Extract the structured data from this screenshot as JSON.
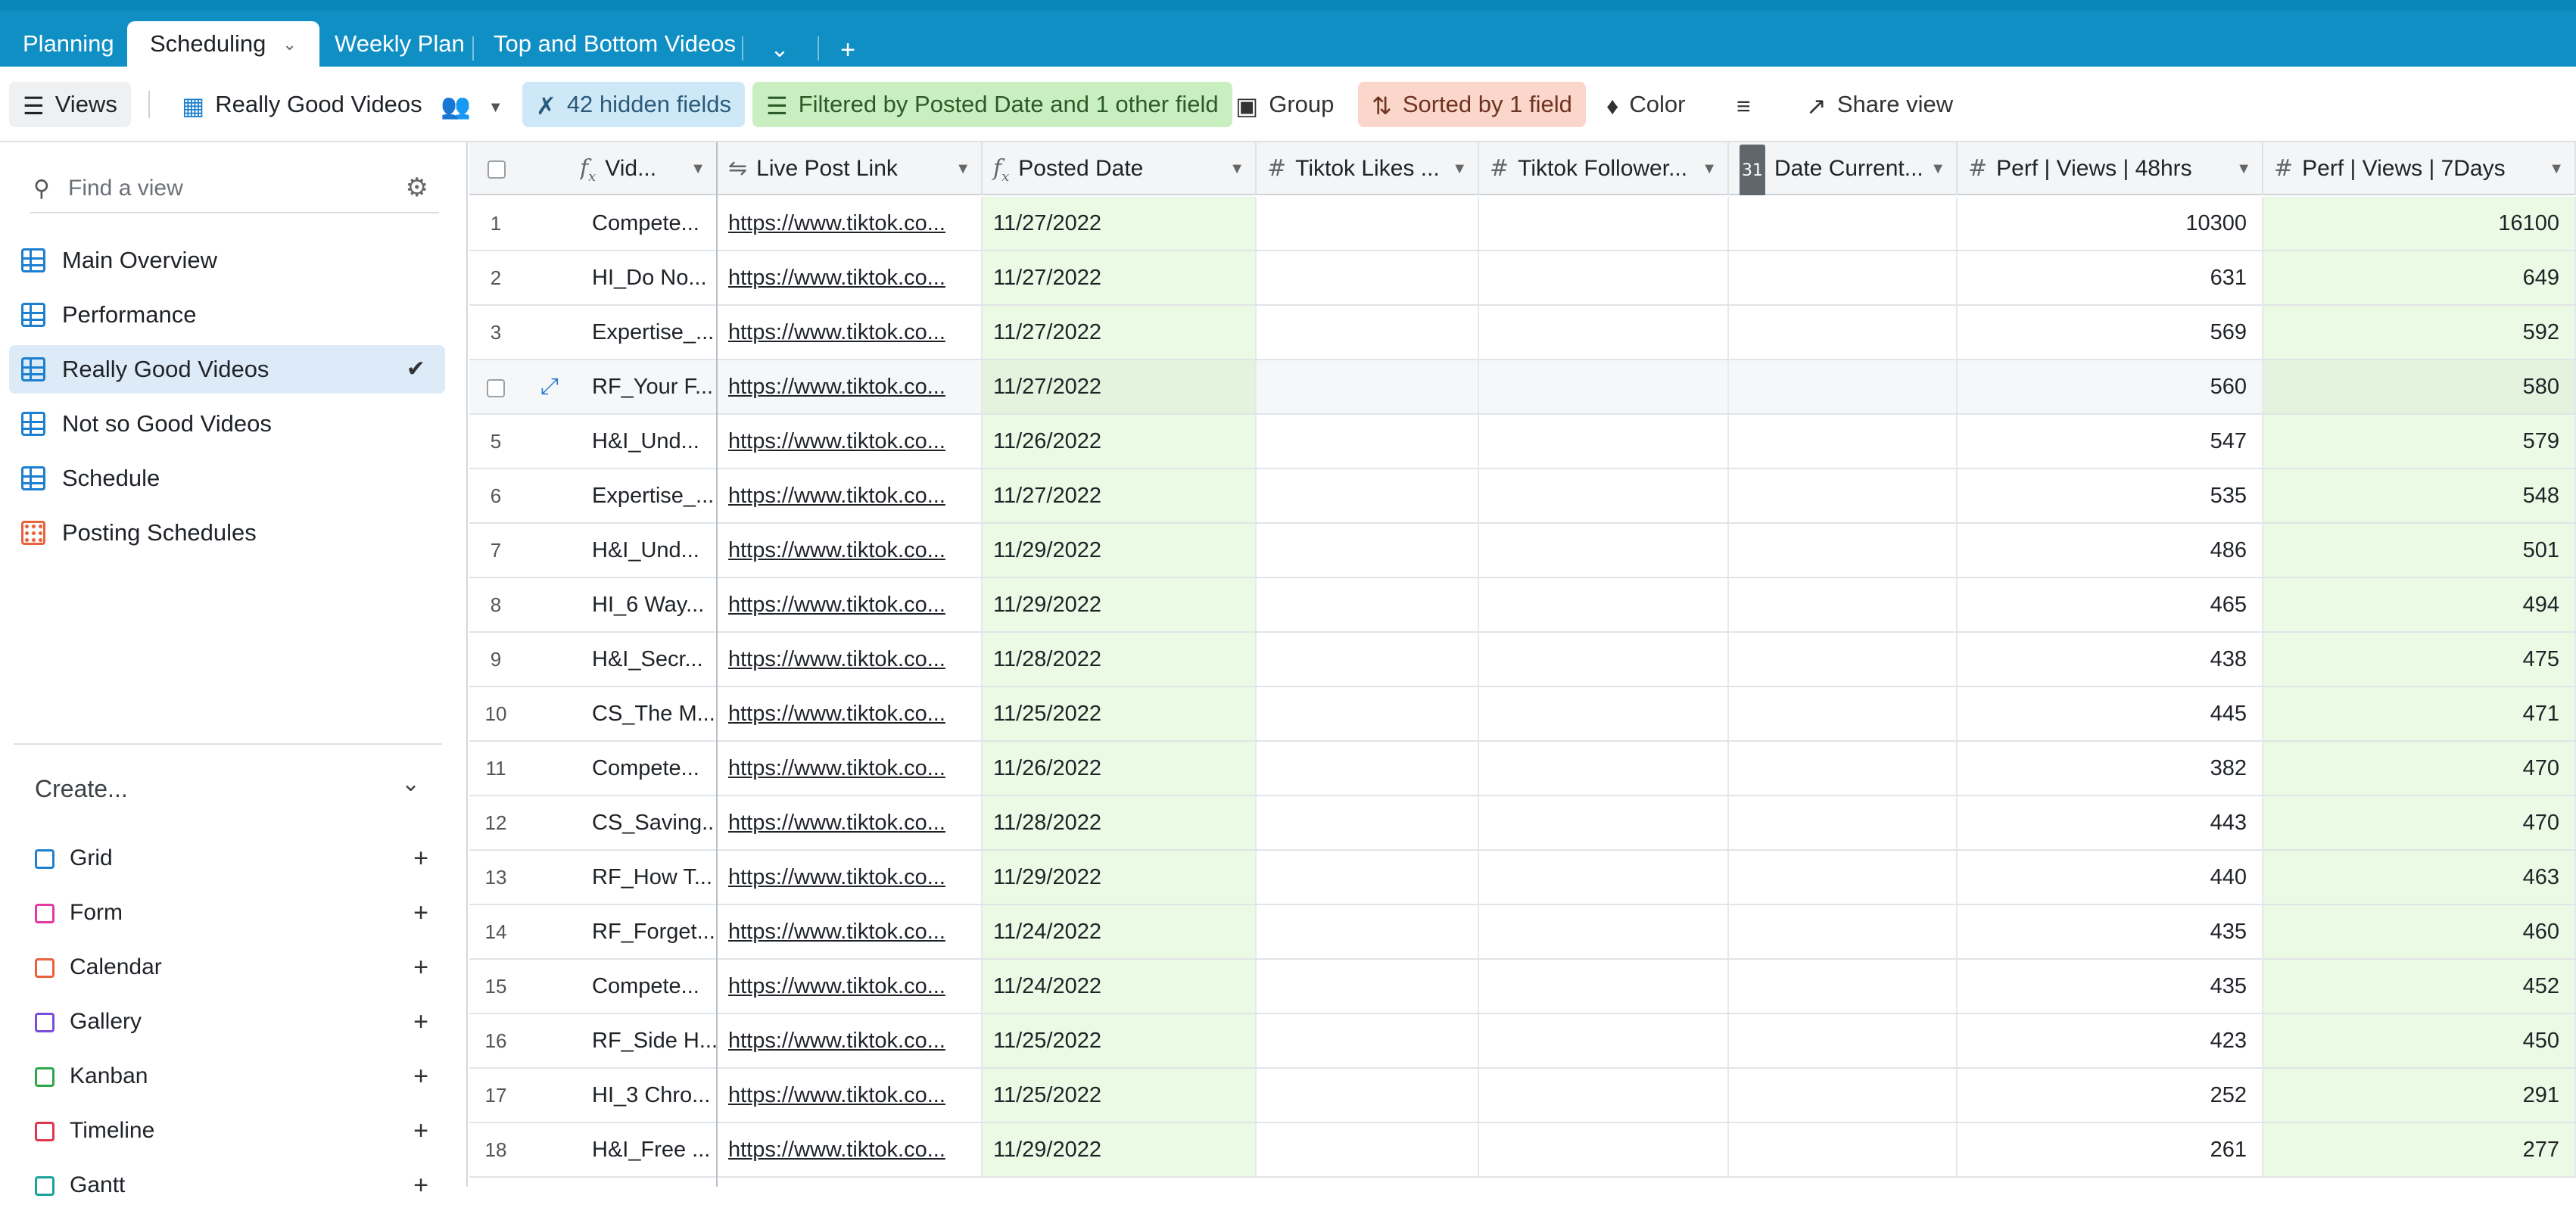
{
  "tabs": [
    {
      "label": "Planning",
      "active": false
    },
    {
      "label": "Scheduling",
      "active": true
    },
    {
      "label": "Weekly Plan",
      "active": false
    },
    {
      "label": "Top and Bottom Videos",
      "active": false
    }
  ],
  "viewbar": {
    "views_label": "Views",
    "current_view": "Really Good Videos",
    "hidden_fields": "42 hidden fields",
    "filter": "Filtered by Posted Date and 1 other field",
    "group": "Group",
    "sort": "Sorted by 1 field",
    "color": "Color",
    "share": "Share view"
  },
  "sidebar": {
    "find_placeholder": "Find a view",
    "views": [
      {
        "label": "Main Overview",
        "icon": "grid-icon",
        "selected": false
      },
      {
        "label": "Performance",
        "icon": "grid-icon",
        "selected": false
      },
      {
        "label": "Really Good Videos",
        "icon": "grid-icon",
        "selected": true
      },
      {
        "label": "Not so Good Videos",
        "icon": "grid-icon",
        "selected": false
      },
      {
        "label": "Schedule",
        "icon": "grid-icon",
        "selected": false
      },
      {
        "label": "Posting Schedules",
        "icon": "calendar-icon",
        "selected": false
      }
    ],
    "create_title": "Create...",
    "create_items": [
      {
        "label": "Grid",
        "color": "#1d7fcf"
      },
      {
        "label": "Form",
        "color": "#e33aa3"
      },
      {
        "label": "Calendar",
        "color": "#e8623b"
      },
      {
        "label": "Gallery",
        "color": "#7b4ddb"
      },
      {
        "label": "Kanban",
        "color": "#2aa84a"
      },
      {
        "label": "Timeline",
        "color": "#e0364f"
      },
      {
        "label": "Gantt",
        "color": "#1aa39a"
      }
    ]
  },
  "grid": {
    "columns": [
      {
        "label": "Vid...",
        "type": "formula"
      },
      {
        "label": "Live Post Link",
        "type": "link"
      },
      {
        "label": "Posted Date",
        "type": "formula"
      },
      {
        "label": "Tiktok Likes ...",
        "type": "number"
      },
      {
        "label": "Tiktok Follower...",
        "type": "number"
      },
      {
        "label": "Date Current...",
        "type": "date"
      },
      {
        "label": "Perf | Views | 48hrs",
        "type": "number"
      },
      {
        "label": "Perf | Views | 7Days",
        "type": "number"
      }
    ],
    "rows": [
      {
        "n": "1",
        "vid": "Compete...",
        "link": "https://www.tiktok.co...",
        "date": "11/27/2022",
        "v48": "10300",
        "v7": "16100"
      },
      {
        "n": "2",
        "vid": "HI_Do No...",
        "link": "https://www.tiktok.co...",
        "date": "11/27/2022",
        "v48": "631",
        "v7": "649"
      },
      {
        "n": "3",
        "vid": "Expertise_...",
        "link": "https://www.tiktok.co...",
        "date": "11/27/2022",
        "v48": "569",
        "v7": "592"
      },
      {
        "n": "",
        "vid": "RF_Your F...",
        "link": "https://www.tiktok.co...",
        "date": "11/27/2022",
        "v48": "560",
        "v7": "580",
        "hover": true
      },
      {
        "n": "5",
        "vid": "H&I_Und...",
        "link": "https://www.tiktok.co...",
        "date": "11/26/2022",
        "v48": "547",
        "v7": "579"
      },
      {
        "n": "6",
        "vid": "Expertise_...",
        "link": "https://www.tiktok.co...",
        "date": "11/27/2022",
        "v48": "535",
        "v7": "548"
      },
      {
        "n": "7",
        "vid": "H&I_Und...",
        "link": "https://www.tiktok.co...",
        "date": "11/29/2022",
        "v48": "486",
        "v7": "501"
      },
      {
        "n": "8",
        "vid": "HI_6 Way...",
        "link": "https://www.tiktok.co...",
        "date": "11/29/2022",
        "v48": "465",
        "v7": "494"
      },
      {
        "n": "9",
        "vid": "H&I_Secr...",
        "link": "https://www.tiktok.co...",
        "date": "11/28/2022",
        "v48": "438",
        "v7": "475"
      },
      {
        "n": "10",
        "vid": "CS_The M...",
        "link": "https://www.tiktok.co...",
        "date": "11/25/2022",
        "v48": "445",
        "v7": "471"
      },
      {
        "n": "11",
        "vid": "Compete...",
        "link": "https://www.tiktok.co...",
        "date": "11/26/2022",
        "v48": "382",
        "v7": "470"
      },
      {
        "n": "12",
        "vid": "CS_Saving...",
        "link": "https://www.tiktok.co...",
        "date": "11/28/2022",
        "v48": "443",
        "v7": "470"
      },
      {
        "n": "13",
        "vid": "RF_How T...",
        "link": "https://www.tiktok.co...",
        "date": "11/29/2022",
        "v48": "440",
        "v7": "463"
      },
      {
        "n": "14",
        "vid": "RF_Forget...",
        "link": "https://www.tiktok.co...",
        "date": "11/24/2022",
        "v48": "435",
        "v7": "460"
      },
      {
        "n": "15",
        "vid": "Compete...",
        "link": "https://www.tiktok.co...",
        "date": "11/24/2022",
        "v48": "435",
        "v7": "452"
      },
      {
        "n": "16",
        "vid": "RF_Side H...",
        "link": "https://www.tiktok.co...",
        "date": "11/25/2022",
        "v48": "423",
        "v7": "450"
      },
      {
        "n": "17",
        "vid": "HI_3 Chro...",
        "link": "https://www.tiktok.co...",
        "date": "11/25/2022",
        "v48": "252",
        "v7": "291"
      },
      {
        "n": "18",
        "vid": "H&I_Free ...",
        "link": "https://www.tiktok.co...",
        "date": "11/29/2022",
        "v48": "261",
        "v7": "277"
      }
    ]
  }
}
